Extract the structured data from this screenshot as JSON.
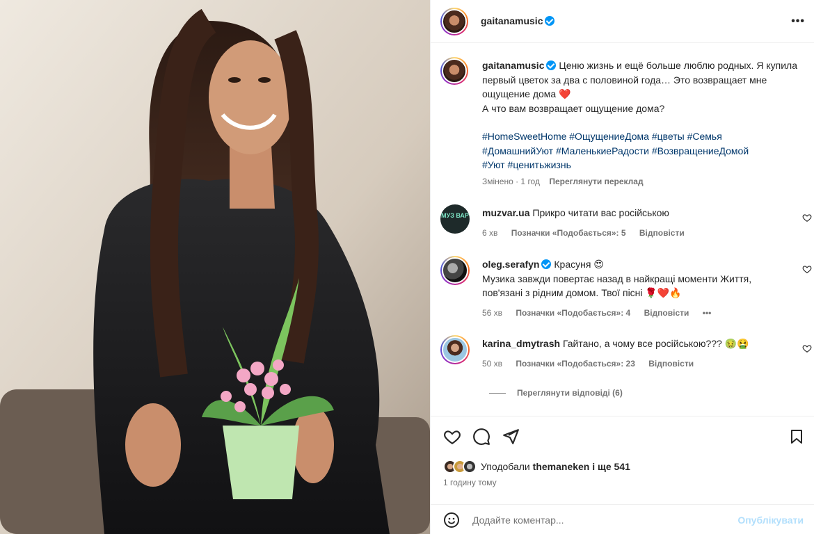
{
  "post": {
    "username": "gaitanamusic",
    "caption": {
      "text1": "Ценю жизнь и ещё больше люблю родных. Я купила первый цветок за два с половиной года… Это возвращает мне ощущение дома",
      "heart": "❤️",
      "text2": "А что вам возвращает ощущение дома?",
      "tags1": "#HomeSweetHome #ОщущениеДома #цветы #Семья",
      "tags2": "#ДомашнийУют #МаленькиеРадости #ВозвращениеДомой",
      "tags3": "#Уют #ценитьжизнь",
      "edited": "Змінено · 1 год",
      "translate": "Переглянути переклад"
    }
  },
  "comments": [
    {
      "username": "muzvar.ua",
      "avatar_text": "МУЗ ВАР",
      "text": "Прикро читати вас російською",
      "time": "6 хв",
      "likes": "Позначки «Подобається»: 5",
      "reply": "Відповісти"
    },
    {
      "username": "oleg.serafyn",
      "verified": true,
      "text_line1": "Красуня 😍",
      "text_line2": "Музика завжди повертає назад в найкращі моменти Життя, пов'язані з рідним домом. Твої пісні 🌹❤️🔥",
      "time": "56 хв",
      "likes": "Позначки «Подобається»: 4",
      "reply": "Відповісти",
      "more": "•••"
    },
    {
      "username": "karina_dmytrash",
      "text": "Гайтано, а чому все російською??? 🤢🤮",
      "time": "50 хв",
      "likes": "Позначки «Подобається»: 23",
      "reply": "Відповісти"
    }
  ],
  "view_replies": "Переглянути відповіді (6)",
  "likes": {
    "prefix": "Уподобали",
    "user": "themaneken",
    "suffix": "і ще 541"
  },
  "posted_time": "1 годину тому",
  "comment_input": {
    "placeholder": "Додайте коментар..."
  },
  "publish_label": "Опублікувати",
  "colors": {
    "link": "#00376b",
    "verified": "#0095f6",
    "muted": "#737373",
    "publish_disabled": "#b2dffc"
  }
}
